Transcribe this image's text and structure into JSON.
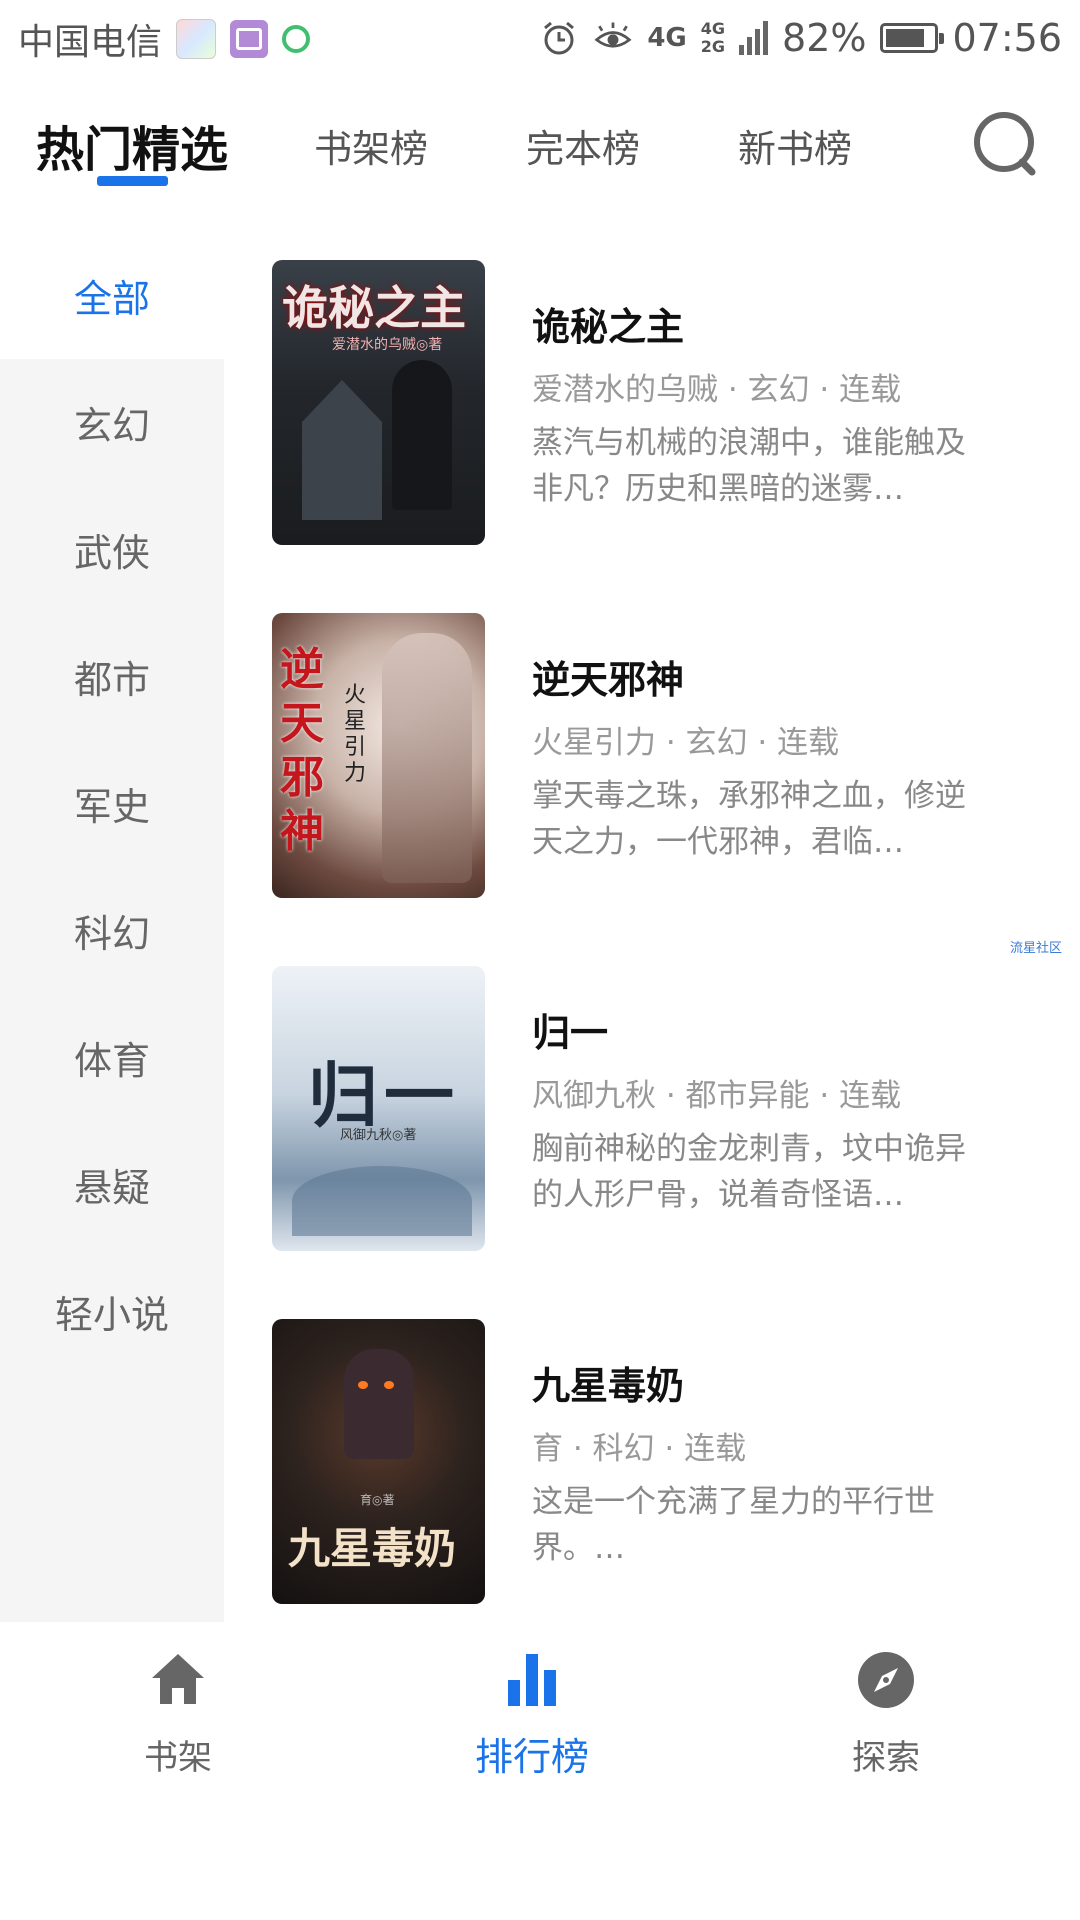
{
  "status_bar": {
    "carrier": "中国电信",
    "network": "4G",
    "network_sub_top": "4G",
    "network_sub_bottom": "2G",
    "battery_percent": "82%",
    "battery_level": 0.82,
    "time": "07:56"
  },
  "top_tabs": [
    {
      "label": "热门精选",
      "active": true
    },
    {
      "label": "书架榜",
      "active": false
    },
    {
      "label": "完本榜",
      "active": false
    },
    {
      "label": "新书榜",
      "active": false
    }
  ],
  "categories": [
    {
      "label": "全部",
      "active": true
    },
    {
      "label": "玄幻"
    },
    {
      "label": "武侠"
    },
    {
      "label": "都市"
    },
    {
      "label": "军史"
    },
    {
      "label": "科幻"
    },
    {
      "label": "体育"
    },
    {
      "label": "悬疑"
    },
    {
      "label": "轻小说"
    }
  ],
  "books": [
    {
      "title": "诡秘之主",
      "meta": "爱潜水的乌贼  ·  玄幻  ·  连载",
      "description": "蒸汽与机械的浪潮中，谁能触及非凡？历史和黑暗的迷雾…",
      "cover_text": "诡秘之主",
      "cover_author": "爱潜水的乌贼◎著"
    },
    {
      "title": "逆天邪神",
      "meta": "火星引力  ·  玄幻  ·  连载",
      "description": "掌天毒之珠，承邪神之血，修逆天之力，一代邪神，君临…",
      "cover_text": "逆天邪神",
      "cover_author": "火星引力"
    },
    {
      "title": "归一",
      "meta": "风御九秋  ·  都市异能  ·  连载",
      "description": "胸前神秘的金龙刺青，坟中诡异的人形尸骨，说着奇怪语…",
      "cover_text": "归一",
      "cover_author": "风御九秋◎著"
    },
    {
      "title": "九星毒奶",
      "meta": "育  ·  科幻  ·  连载",
      "description": "这是一个充满了星力的平行世界。…",
      "cover_text": "九星毒奶",
      "cover_author": "育◎著"
    }
  ],
  "watermark": "流星社区",
  "bottom_nav": [
    {
      "label": "书架",
      "icon": "home-icon",
      "active": false
    },
    {
      "label": "排行榜",
      "icon": "bar-chart-icon",
      "active": true
    },
    {
      "label": "探索",
      "icon": "compass-icon",
      "active": false
    }
  ],
  "colors": {
    "accent": "#1a73e8",
    "sidebar_bg": "#f5f5f5"
  }
}
